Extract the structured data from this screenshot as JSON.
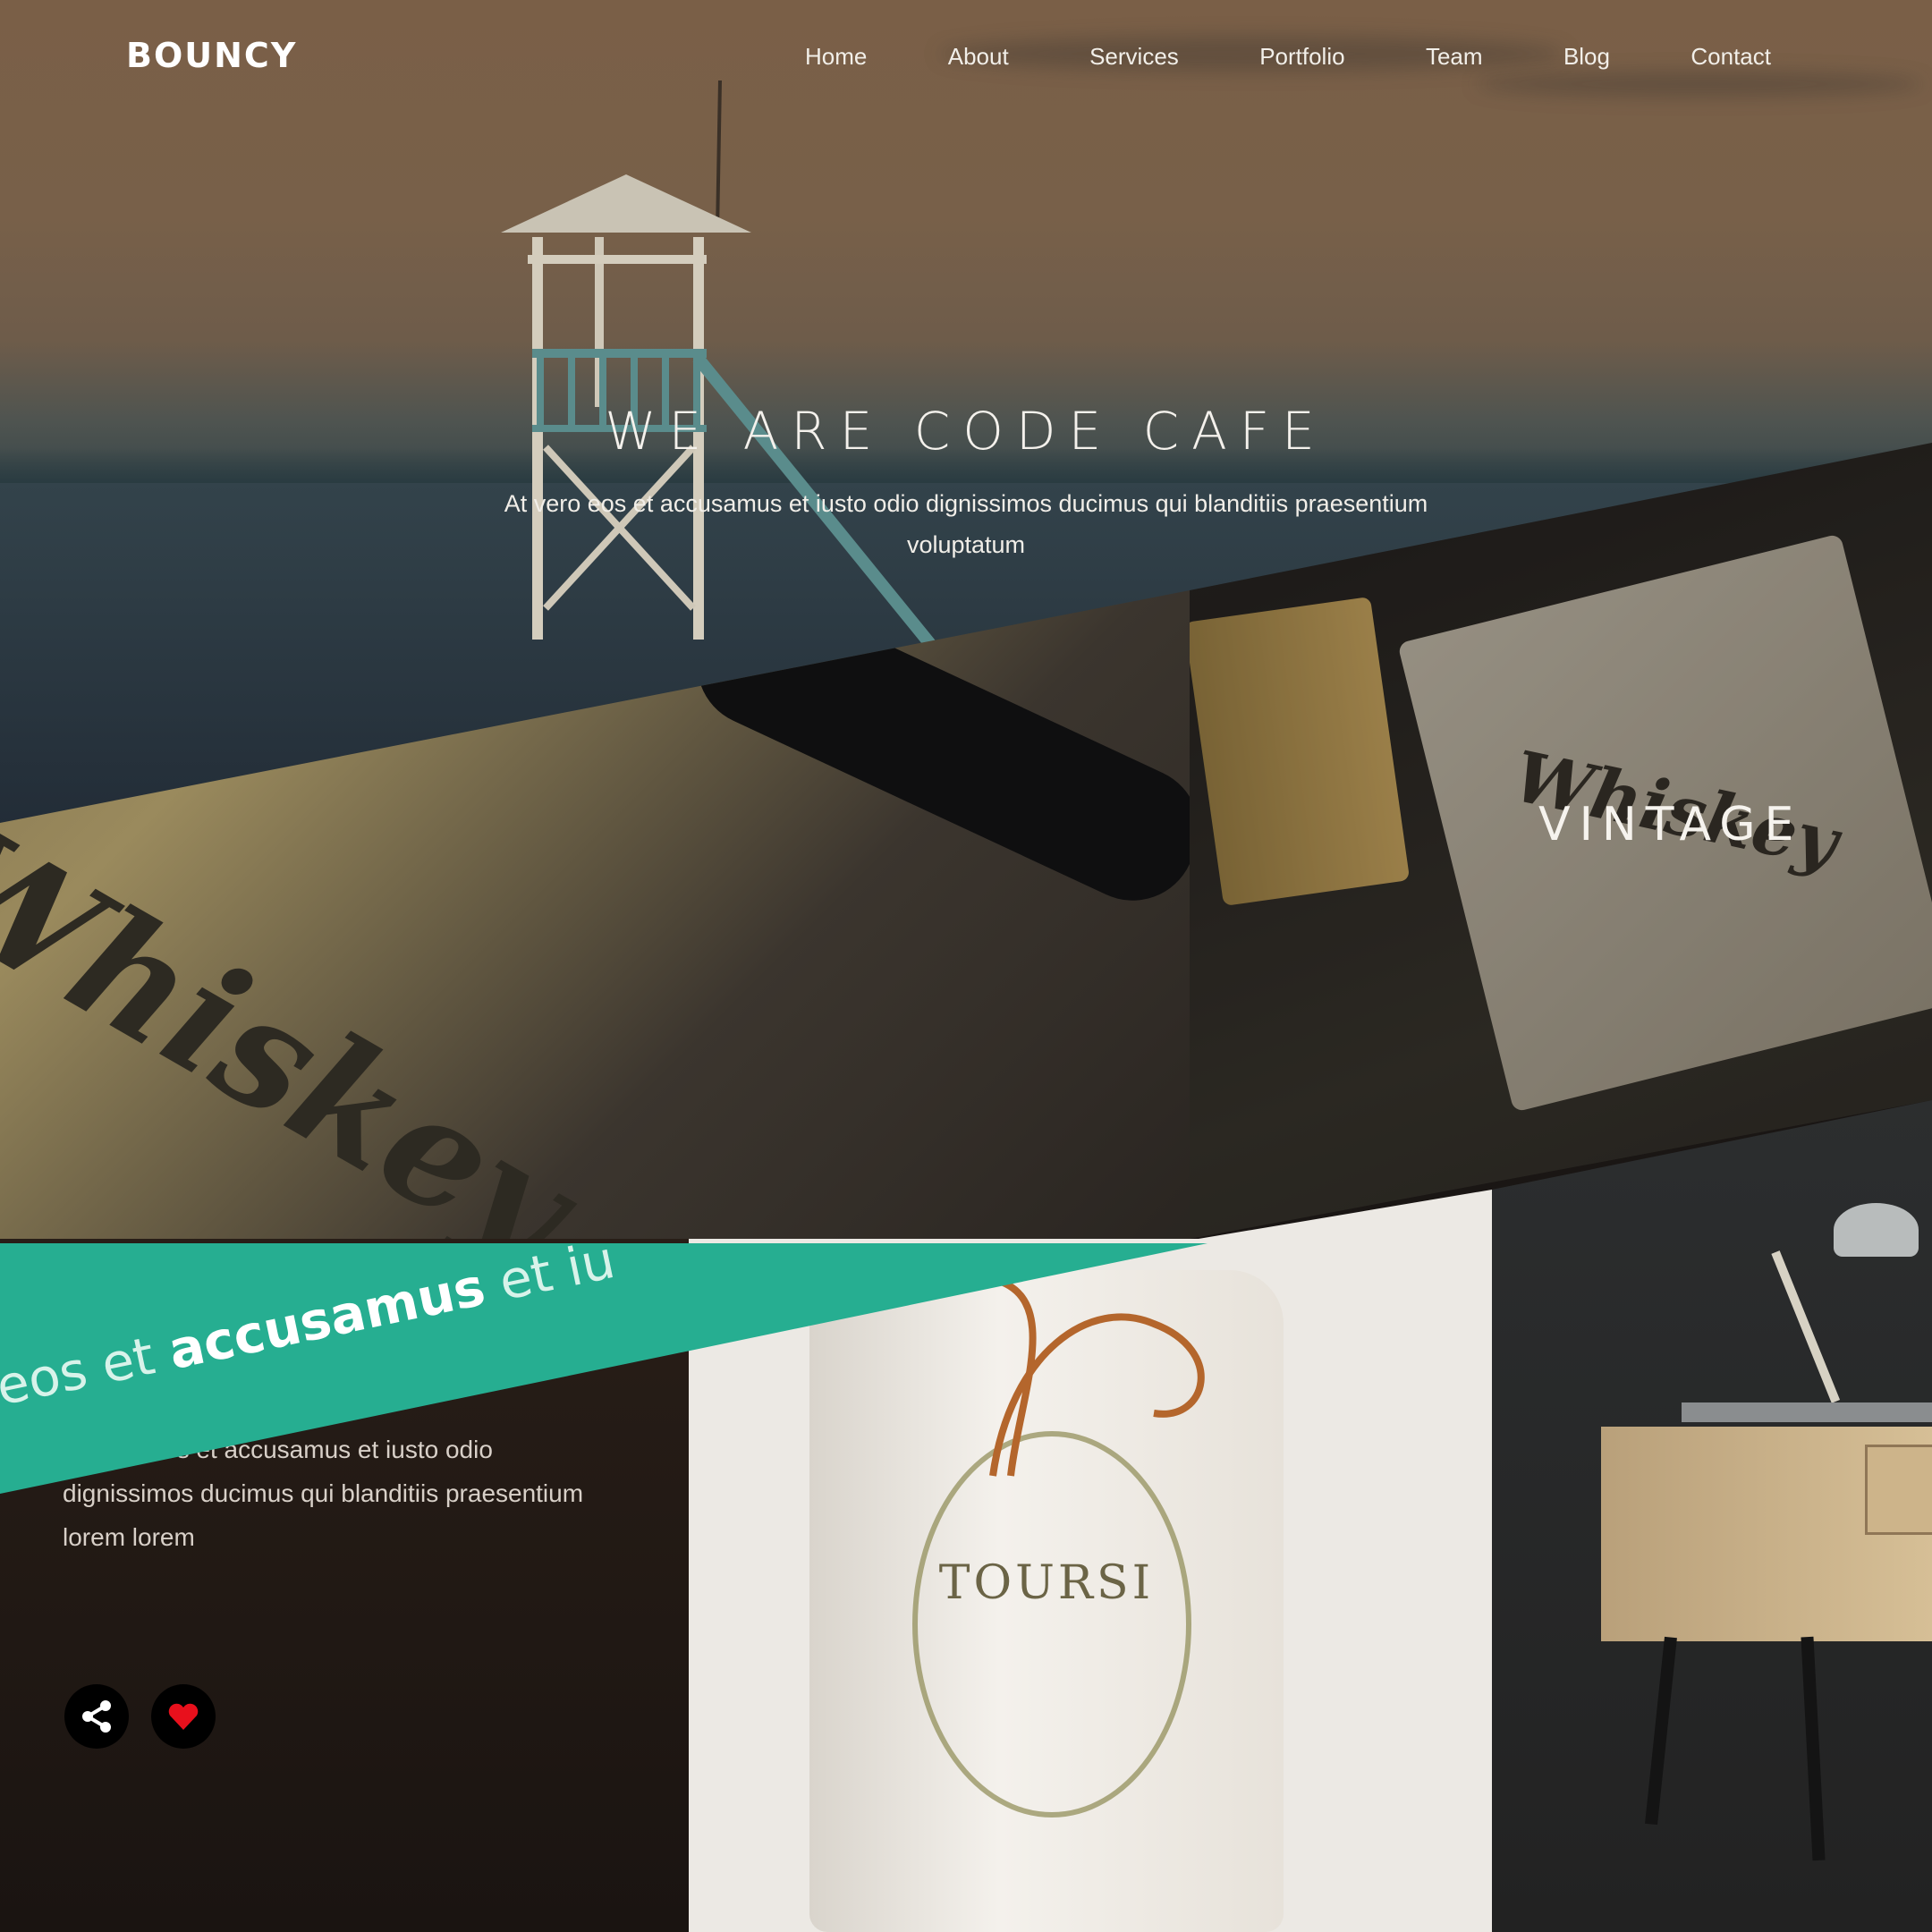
{
  "brand": "BOUNCY",
  "nav": [
    "Home",
    "About",
    "Services",
    "Portfolio",
    "Team",
    "Blog",
    "Contact"
  ],
  "hero": {
    "title": "WE ARE CODE CAFE",
    "text": "At vero eos et accusamus et iusto odio dignissimos ducimus qui blanditiis praesentium voluptatum"
  },
  "tiles": {
    "whiskey_label": "Whiskey",
    "vintage_label": "VINTAGE",
    "band_lead": "eos et ",
    "band_bold": "accusamus",
    "band_tail": " et iu",
    "card_text": "At vero eos et accusamus et iusto odio dignissimos ducimus qui blanditiis praesentium lorem lorem",
    "bag_label": "TOURSI"
  },
  "icons": {
    "share": "share-icon",
    "like": "heart-icon"
  },
  "colors": {
    "accent": "#26ae91",
    "heart": "#e8101c"
  }
}
